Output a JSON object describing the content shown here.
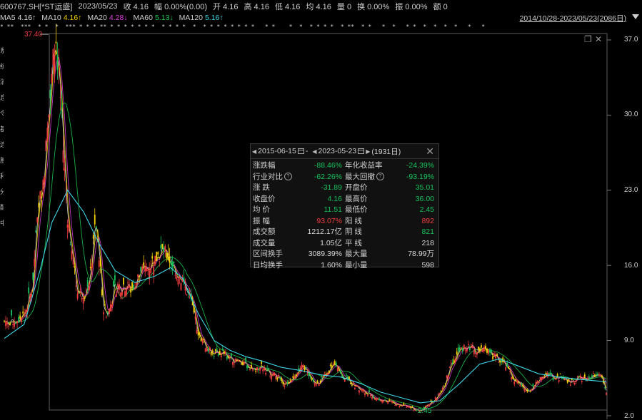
{
  "header": {
    "code": "600767.SH[*ST运盛]",
    "date": "2023/05/23",
    "close": "收 4.16",
    "change": "幅 0.00%(0.00)",
    "open": "开 4.16",
    "high": "高 4.16",
    "low": "低 4.16",
    "avg": "均 4.16",
    "volume": "量 0",
    "turnover": "换 0.00%",
    "amplitude": "振 0.00%",
    "amount": "额 0"
  },
  "ma": [
    {
      "name": "MA5",
      "value": "4.16↑",
      "color": "#e8e8e8"
    },
    {
      "name": "MA10",
      "value": "4.16↑",
      "color": "#f5d200"
    },
    {
      "name": "MA20",
      "value": "4.28↓",
      "color": "#e040e0"
    },
    {
      "name": "MA60",
      "value": "5.13↓",
      "color": "#1fcf4f"
    },
    {
      "name": "MA120",
      "value": "5.16↑",
      "color": "#3dd6e6"
    }
  ],
  "range_label": "2014/10/28-2023/05/23(2086日)",
  "y_axis": {
    "ticks": [
      "37.0",
      "30.0",
      "23.0",
      "16.0",
      "9.0",
      "2.0"
    ]
  },
  "max_label": "37.40",
  "min_label": "2.45",
  "tooltip": {
    "start_date": "2015-06-15",
    "separator": "-",
    "end_date": "2023-05-23",
    "days": "(1931日)",
    "rows": [
      {
        "label": "涨跌幅",
        "value": "-88.46%",
        "color": "g"
      },
      {
        "label": "年化收益率",
        "value": "-24.39%",
        "color": "g"
      },
      {
        "label": "行业对比",
        "value": "-62.26%",
        "color": "g",
        "help": true
      },
      {
        "label": "最大回撤",
        "value": "-93.19%",
        "color": "g",
        "help": true
      },
      {
        "label": "涨 跌",
        "value": "-31.89",
        "color": "g"
      },
      {
        "label": "开盘价",
        "value": "35.01",
        "color": "g"
      },
      {
        "label": "收盘价",
        "value": "4.16",
        "color": "g"
      },
      {
        "label": "最高价",
        "value": "36.00",
        "color": "g"
      },
      {
        "label": "均 价",
        "value": "11.51",
        "color": "g"
      },
      {
        "label": "最低价",
        "value": "2.45",
        "color": "g"
      },
      {
        "label": "振 幅",
        "value": "93.07%",
        "color": "r"
      },
      {
        "label": "阳 线",
        "value": "892",
        "color": "r"
      },
      {
        "label": "成交额",
        "value": "1212.17亿",
        "color": "w"
      },
      {
        "label": "阴 线",
        "value": "821",
        "color": "g"
      },
      {
        "label": "成交量",
        "value": "1.05亿",
        "color": "w"
      },
      {
        "label": "平 线",
        "value": "218",
        "color": "w"
      },
      {
        "label": "区间换手",
        "value": "3089.39%",
        "color": "w"
      },
      {
        "label": "最大量",
        "value": "78.99万",
        "color": "w"
      },
      {
        "label": "日均换手",
        "value": "1.60%",
        "color": "w"
      },
      {
        "label": "最小量",
        "value": "598",
        "color": "w"
      }
    ]
  },
  "left_strip": [
    "系",
    "统",
    "消",
    "息",
    "令",
    "基",
    "连",
    "股",
    "利",
    "分",
    "配",
    "中"
  ],
  "star_marks": "* **  ***  * *  *  *** * * * ** * * * * * * *  * * * *  *  * * * * * * * *   * *    *  *  * * * *  * **  * *   *  *   * *  *  *  *  *   *   *",
  "colors": {
    "up": "#f03c3c",
    "down": "#18c25b",
    "ma5": "#e8e8e8",
    "ma10": "#f5d200",
    "ma20": "#e040e0",
    "ma60": "#1fcf4f",
    "ma120": "#3dd6e6"
  },
  "chart_data": {
    "type": "line",
    "title": "",
    "x_range": [
      "2014/10/28",
      "2023/05/23"
    ],
    "ylim": [
      2.0,
      37.0
    ],
    "price_outline": [
      [
        0,
        10.8
      ],
      [
        3,
        10.9
      ],
      [
        5,
        11.4
      ],
      [
        7,
        13.8
      ],
      [
        8,
        18.5
      ],
      [
        9,
        22.0
      ],
      [
        10,
        24.5
      ],
      [
        11,
        29.0
      ],
      [
        12,
        33.5
      ],
      [
        13,
        37.4
      ],
      [
        14,
        33.0
      ],
      [
        15,
        26.0
      ],
      [
        16,
        20.5
      ],
      [
        17,
        17.5
      ],
      [
        18,
        14.5
      ],
      [
        19,
        13.4
      ],
      [
        20,
        13.6
      ],
      [
        21,
        13.4
      ],
      [
        22,
        16.0
      ],
      [
        23,
        20.0
      ],
      [
        24,
        17.0
      ],
      [
        25,
        12.2
      ],
      [
        26,
        11.4
      ],
      [
        27,
        12.6
      ],
      [
        28,
        14.0
      ],
      [
        30,
        14.2
      ],
      [
        32,
        13.8
      ],
      [
        34,
        15.0
      ],
      [
        36,
        15.6
      ],
      [
        38,
        16.6
      ],
      [
        40,
        17.4
      ],
      [
        41,
        17.0
      ],
      [
        43,
        15.8
      ],
      [
        45,
        14.6
      ],
      [
        47,
        12.8
      ],
      [
        49,
        9.8
      ],
      [
        51,
        8.3
      ],
      [
        53,
        7.8
      ],
      [
        55,
        7.9
      ],
      [
        57,
        7.4
      ],
      [
        59,
        7.0
      ],
      [
        61,
        6.8
      ],
      [
        63,
        6.3
      ],
      [
        65,
        6.6
      ],
      [
        67,
        6.0
      ],
      [
        69,
        5.6
      ],
      [
        71,
        5.0
      ],
      [
        73,
        5.5
      ],
      [
        75,
        6.8
      ],
      [
        77,
        5.8
      ],
      [
        79,
        5.0
      ],
      [
        81,
        5.6
      ],
      [
        83,
        6.9
      ],
      [
        85,
        5.8
      ],
      [
        87,
        5.3
      ],
      [
        89,
        4.6
      ],
      [
        91,
        4.3
      ],
      [
        93,
        3.8
      ],
      [
        95,
        3.5
      ],
      [
        97,
        3.3
      ],
      [
        99,
        3.1
      ],
      [
        101,
        2.9
      ],
      [
        103,
        2.7
      ],
      [
        105,
        2.45
      ],
      [
        107,
        3.0
      ],
      [
        109,
        3.6
      ],
      [
        111,
        4.8
      ],
      [
        113,
        6.8
      ],
      [
        115,
        8.1
      ],
      [
        117,
        8.6
      ],
      [
        119,
        7.9
      ],
      [
        121,
        8.2
      ],
      [
        123,
        7.6
      ],
      [
        125,
        7.2
      ],
      [
        127,
        6.5
      ],
      [
        129,
        5.2
      ],
      [
        131,
        4.6
      ],
      [
        133,
        4.4
      ],
      [
        135,
        5.4
      ],
      [
        137,
        6.0
      ],
      [
        139,
        5.4
      ],
      [
        141,
        5.7
      ],
      [
        143,
        5.0
      ],
      [
        145,
        5.6
      ],
      [
        147,
        5.4
      ],
      [
        149,
        5.8
      ],
      [
        151,
        5.5
      ],
      [
        152,
        4.16
      ]
    ],
    "ma120_outline": [
      [
        0,
        9.2
      ],
      [
        5,
        10.5
      ],
      [
        9,
        15.5
      ],
      [
        12,
        20.0
      ],
      [
        16,
        23.0
      ],
      [
        20,
        21.0
      ],
      [
        24,
        18.0
      ],
      [
        28,
        15.5
      ],
      [
        33,
        14.4
      ],
      [
        38,
        15.0
      ],
      [
        42,
        15.8
      ],
      [
        45,
        14.8
      ],
      [
        49,
        11.5
      ],
      [
        53,
        9.0
      ],
      [
        57,
        8.1
      ],
      [
        61,
        7.5
      ],
      [
        65,
        7.1
      ],
      [
        70,
        6.5
      ],
      [
        75,
        6.2
      ],
      [
        80,
        5.8
      ],
      [
        85,
        5.6
      ],
      [
        90,
        5.0
      ],
      [
        95,
        4.2
      ],
      [
        100,
        3.7
      ],
      [
        105,
        3.2
      ],
      [
        110,
        3.4
      ],
      [
        115,
        5.0
      ],
      [
        120,
        6.8
      ],
      [
        125,
        7.3
      ],
      [
        130,
        6.6
      ],
      [
        135,
        5.9
      ],
      [
        140,
        5.6
      ],
      [
        145,
        5.4
      ],
      [
        152,
        5.16
      ]
    ]
  }
}
